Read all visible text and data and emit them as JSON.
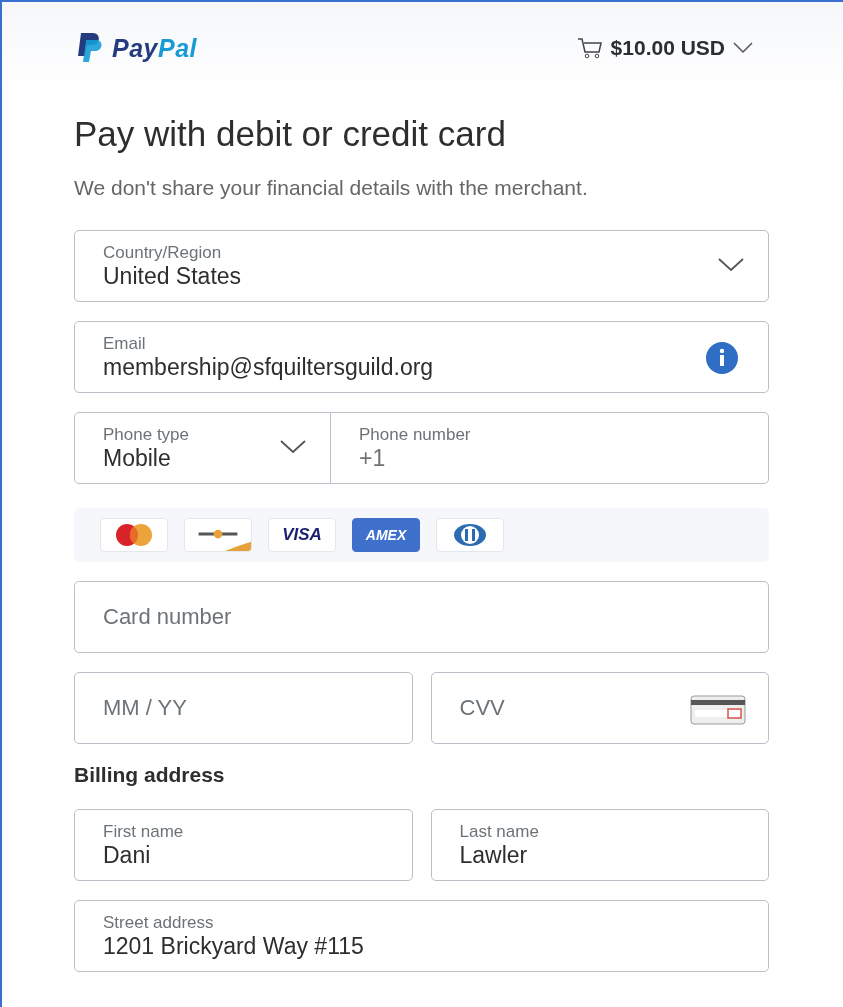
{
  "header": {
    "logo_parts": [
      "Pay",
      "Pal"
    ],
    "amount": "$10.00 USD"
  },
  "title": "Pay with debit or credit card",
  "subtitle": "We don't share your financial details with the merchant.",
  "contact_rows": [
    [
      {
        "kind": "select",
        "label": "Country/Region",
        "value": "United States"
      }
    ],
    [
      {
        "kind": "info",
        "label": "Email",
        "value": "membership@sfquiltersguild.org"
      }
    ],
    [
      {
        "kind": "select",
        "label": "Phone type",
        "value": "Mobile"
      },
      {
        "label": "Phone number",
        "placeholder": "+1"
      }
    ]
  ],
  "card_brands": [
    {
      "kind": "mastercard"
    },
    {
      "kind": "discover"
    },
    {
      "kind": "visa",
      "label": "VISA"
    },
    {
      "kind": "amex",
      "label": "AMEX"
    },
    {
      "kind": "diners"
    }
  ],
  "card_rows": [
    [
      {
        "placeholder": "Card number"
      }
    ],
    [
      {
        "placeholder": "MM / YY"
      },
      {
        "kind": "cvv",
        "placeholder": "CVV"
      }
    ]
  ],
  "billing_heading": "Billing address",
  "billing_rows": [
    [
      {
        "label": "First name",
        "value": "Dani"
      },
      {
        "label": "Last name",
        "value": "Lawler"
      }
    ],
    [
      {
        "label": "Street address",
        "value": "1201 Brickyard Way #115"
      }
    ]
  ]
}
